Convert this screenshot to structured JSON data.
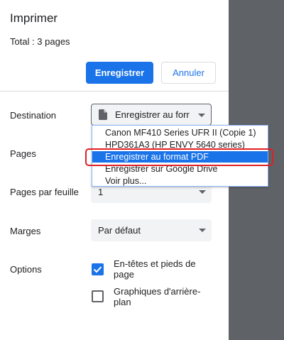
{
  "header": {
    "title": "Imprimer",
    "total": "Total : 3 pages"
  },
  "actions": {
    "save_label": "Enregistrer",
    "cancel_label": "Annuler"
  },
  "destination": {
    "label": "Destination",
    "selected": "Enregistrer au forr",
    "icon": "document-icon",
    "options": [
      "Canon MF410 Series UFR II (Copie 1)",
      "HPD361A3 (HP ENVY 5640 series)",
      "Enregistrer au format PDF",
      "Enregistrer sur Google Drive",
      "Voir plus..."
    ],
    "highlighted_option": "Enregistrer au format PDF"
  },
  "pages": {
    "label": "Pages"
  },
  "pages_per_sheet": {
    "label": "Pages par feuille",
    "value": "1"
  },
  "margins": {
    "label": "Marges",
    "value": "Par défaut"
  },
  "options": {
    "label": "Options",
    "headers_footers": {
      "label": "En-têtes et pieds de page",
      "checked": true
    },
    "background_graphics": {
      "label": "Graphiques d'arrière-plan",
      "checked": false
    }
  },
  "colors": {
    "accent": "#1a73e8",
    "highlight_ring": "#e01f26",
    "side_panel": "#5f6368"
  }
}
